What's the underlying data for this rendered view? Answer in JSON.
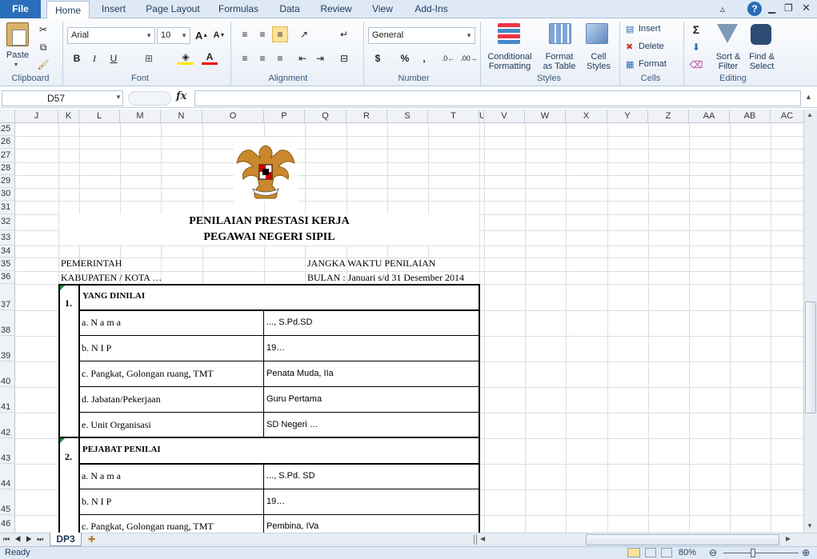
{
  "ribbon": {
    "tabs": [
      "File",
      "Home",
      "Insert",
      "Page Layout",
      "Formulas",
      "Data",
      "Review",
      "View",
      "Add-Ins"
    ],
    "clipboard": {
      "paste": "Paste",
      "label": "Clipboard"
    },
    "font": {
      "name": "Arial",
      "size": "10",
      "label": "Font",
      "bold": "B",
      "italic": "I",
      "underline": "U"
    },
    "alignment": {
      "label": "Alignment"
    },
    "number": {
      "format": "General",
      "label": "Number",
      "currency": "$",
      "percent": "%",
      "comma": ","
    },
    "styles": {
      "conditional": "Conditional",
      "conditional2": "Formatting",
      "format_table": "Format",
      "format_table2": "as Table",
      "cell_styles": "Cell",
      "cell_styles2": "Styles",
      "label": "Styles"
    },
    "cells": {
      "insert": "Insert",
      "delete": "Delete",
      "format": "Format",
      "label": "Cells"
    },
    "editing": {
      "sum": "Σ",
      "sort": "Sort &",
      "sort2": "Filter",
      "find": "Find &",
      "find2": "Select",
      "label": "Editing"
    }
  },
  "formula_bar": {
    "name_box": "D57",
    "fx": "fx",
    "value": ""
  },
  "columns": [
    "J",
    "K",
    "L",
    "M",
    "N",
    "O",
    "P",
    "Q",
    "R",
    "S",
    "T",
    "U",
    "V",
    "W",
    "X",
    "Y",
    "Z",
    "AA",
    "AB",
    "AC"
  ],
  "rows": [
    "25",
    "26",
    "27",
    "28",
    "29",
    "30",
    "31",
    "32",
    "33",
    "34",
    "35",
    "36",
    "37",
    "38",
    "39",
    "40",
    "41",
    "42",
    "43",
    "44",
    "45",
    "46"
  ],
  "doc": {
    "title1": "PENILAIAN PRESTASI KERJA",
    "title2": "PEGAWAI NEGERI SIPIL",
    "left1": "PEMERINTAH",
    "left2": "KABUPATEN / KOTA …",
    "right1": "JANGKA WAKTU PENILAIAN",
    "right2": "BULAN   : Januari s/d 31 Desember 2014",
    "section1": {
      "num": "1.",
      "title": "YANG DINILAI",
      "items": [
        {
          "label": "a.  N a m a",
          "value": "..., S.Pd.SD"
        },
        {
          "label": "b.  N I P",
          "value": "19…"
        },
        {
          "label": "c.  Pangkat, Golongan ruang, TMT",
          "value": "Penata Muda, IIa"
        },
        {
          "label": "d.  Jabatan/Pekerjaan",
          "value": "Guru Pertama"
        },
        {
          "label": "e.  Unit Organisasi",
          "value": "SD Negeri …"
        }
      ]
    },
    "section2": {
      "num": "2.",
      "title": "PEJABAT PENILAI",
      "items": [
        {
          "label": "a.  N a m a",
          "value": "..., S.Pd. SD"
        },
        {
          "label": "b.  N I P",
          "value": "19…"
        },
        {
          "label": "c.  Pangkat, Golongan ruang, TMT",
          "value": "Pembina, IVa"
        }
      ]
    }
  },
  "sheet_tab": "DP3",
  "status": {
    "ready": "Ready",
    "zoom": "80%"
  }
}
